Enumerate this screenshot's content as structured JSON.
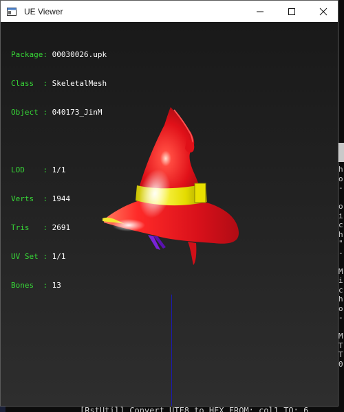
{
  "window": {
    "title": "UE Viewer",
    "app_icon": "window-icon",
    "controls": {
      "minimize": "minimize-icon",
      "maximize": "maximize-icon",
      "close": "close-icon"
    }
  },
  "info": {
    "package": {
      "key": "Package: ",
      "value": "00030026.upk"
    },
    "class": {
      "key": "Class  : ",
      "value": "SkeletalMesh"
    },
    "object": {
      "key": "Object : ",
      "value": "040173_JinM"
    },
    "lod": {
      "key": "LOD    : ",
      "value": "1/1"
    },
    "verts": {
      "key": "Verts  : ",
      "value": "1944"
    },
    "tris": {
      "key": "Tris   : ",
      "value": "2691"
    },
    "uvset": {
      "key": "UV Set : ",
      "value": "1/1"
    },
    "bones": {
      "key": "Bones  : ",
      "value": "13"
    }
  },
  "console": {
    "bottom_line": "[RstUtil] Convert UTF8 to HEX  FROM: col1  TO: 6",
    "edge_chars": [
      "h",
      "o",
      "-",
      "",
      "o",
      "i",
      "c",
      "h",
      "\"",
      "-",
      "",
      "M",
      "i",
      "c",
      "h",
      "o",
      "-",
      "",
      "M",
      "T",
      "T",
      "0"
    ],
    "desktop_char": "M"
  },
  "colors": {
    "label_green": "#37d837",
    "hat_red": "#e0141a",
    "hat_band": "#e8e000",
    "axis_blue": "#1a1ab0"
  }
}
